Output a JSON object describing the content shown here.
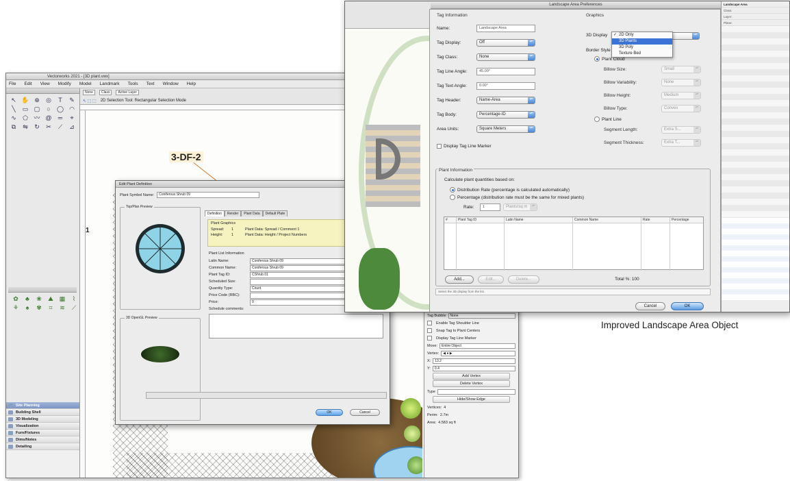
{
  "caption": "Improved Landscape Area Object",
  "back_window": {
    "title": "Vectorworks 2021 - [3D plant.vwx]",
    "menu": [
      "File",
      "Edit",
      "View",
      "Modify",
      "Model",
      "Landmark",
      "Tools",
      "Text",
      "Window",
      "Help"
    ],
    "toolbar_selects": [
      "None",
      "Class",
      "Active Layer"
    ],
    "toolbar_mode_text": "2D Selection Tool: Rectangular Selection Mode",
    "tag_label": "3-DF-2",
    "workspace_sets": [
      "Site Planning",
      "Building Shell",
      "3D Modeling",
      "Visualization",
      "Furn/Fixtures",
      "Dims/Notes",
      "Detailing"
    ],
    "obj_info": {
      "checks": [
        "Tag Bubble",
        "Enable Tag Shoulder Line",
        "Snap Tag to Plant Centers",
        "Display Tag Line Marker"
      ],
      "tag_bubble_value": "None",
      "move_label": "Move:",
      "move_value": "Entire Object",
      "vertex_label": "Vertex:",
      "x_label": "X:",
      "x_value": "13.2",
      "y_label": "Y:",
      "y_value": "0.4",
      "add_vertex": "Add Vertex",
      "delete_vertex": "Delete Vertex",
      "type_label": "Type",
      "hide_edge": "Hide/Show Edge",
      "vertices_label": "Vertices:",
      "vertices_value": "4",
      "perim_label": "Perim:",
      "perim_value": "2.7m",
      "area_label": "Area:",
      "area_value": "4.583 sq ft"
    }
  },
  "plant_dialog": {
    "title": "Edit Plant Definition",
    "symbol_name_label": "Plant Symbol Name:",
    "symbol_name_value": "Coniferous Shrub 09",
    "top_plan_preview": "Top/Plan Preview",
    "opengl_preview": "3D OpenGL Preview",
    "tabs": [
      "Definition",
      "Render",
      "Plant Data",
      "Default Plate"
    ],
    "graphics_header": "Plant Graphics",
    "graphics": [
      {
        "k": "Spread:",
        "v": "1",
        "desc": "Plant Data: Spread / Comment 1"
      },
      {
        "k": "Height:",
        "v": "1",
        "desc": "Plant Data: Height / Project Numbers"
      }
    ],
    "list_header": "Plant List Information",
    "fields": [
      {
        "k": "Latin Name:",
        "v": "Coniferous Shrub 09"
      },
      {
        "k": "Common Name:",
        "v": "Coniferous Shrub 09"
      },
      {
        "k": "Plant Tag ID:",
        "v": "CShrub 01"
      },
      {
        "k": "Scheduled Size:",
        "v": ""
      },
      {
        "k": "Quantity Type:",
        "v": "Count"
      },
      {
        "k": "Price Code (RBC):",
        "v": ""
      },
      {
        "k": "Price:",
        "v": "0"
      },
      {
        "k": "Schedule comments:",
        "v": ""
      }
    ],
    "ok": "OK",
    "cancel": "Cancel"
  },
  "prefs": {
    "title": "Landscape Area Preferences",
    "tag_info_header": "Tag Information",
    "graphics_header": "Graphics",
    "tag_rows": [
      {
        "label": "Name:",
        "value": "Landscape Area",
        "kind": "input"
      },
      {
        "label": "Tag Display:",
        "value": "Off",
        "kind": "select"
      },
      {
        "label": "Tag Class:",
        "value": "None",
        "kind": "select"
      },
      {
        "label": "Tag Line Angle:",
        "value": "45.00°",
        "kind": "input"
      },
      {
        "label": "Tag Text Angle:",
        "value": "0.00°",
        "kind": "input"
      },
      {
        "label": "Tag Header:",
        "value": "Name-Area",
        "kind": "select"
      },
      {
        "label": "Tag Body:",
        "value": "Percentage-ID",
        "kind": "select"
      },
      {
        "label": "Area Units:",
        "value": "Square Meters",
        "kind": "select"
      }
    ],
    "display_tag_marker": "Display Tag Line Marker",
    "display_3d_label": "3D Display",
    "dropdown_items": [
      "2D Only",
      "3D Plants",
      "3D Poly",
      "Texture Bed"
    ],
    "dropdown_checked": "2D Only",
    "dropdown_highlight": "3D Plants",
    "border_style_label": "Border Style",
    "border_options": [
      "Plant Cloud",
      "Plant Line"
    ],
    "cloud_rows": [
      {
        "label": "Billow Size:",
        "value": "Small"
      },
      {
        "label": "Billow Variability:",
        "value": "None"
      },
      {
        "label": "Billow Height:",
        "value": "Medium"
      },
      {
        "label": "Billow Type:",
        "value": "Convex"
      }
    ],
    "line_rows": [
      {
        "label": "Segment Length:",
        "value": "Extra S..."
      },
      {
        "label": "Segment Thickness:",
        "value": "Extra T..."
      }
    ],
    "plant_info_header": "Plant Information",
    "calc_label": "Calculate plant quantities based on:",
    "calc_options": [
      "Distribution Rate (percentage is calculated automatically)",
      "Percentage (distribution rate must be the same for mixed plants)"
    ],
    "rate_label": "Rate:",
    "rate_value": "1",
    "rate_unit": "Plants/sq m",
    "table_headers": [
      "#",
      "Plant Tag ID",
      "Latin Name",
      "Common Name",
      "Rate",
      "Percentage"
    ],
    "add": "Add...",
    "edit": "Edit...",
    "delete": "Delete...",
    "total": "Total %: 100",
    "status_hint": "Select the 3D display from the list.",
    "cancel": "Cancel",
    "ok": "OK"
  },
  "right_panel": {
    "title": "Landscape Area",
    "lines": [
      "Class:",
      "Layer:",
      "Plane:"
    ]
  }
}
